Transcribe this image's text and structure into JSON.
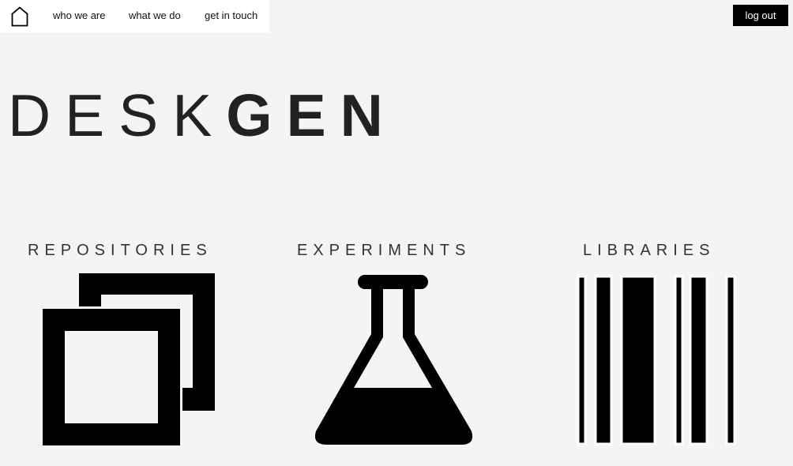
{
  "nav": {
    "home_icon": "home-icon",
    "links": [
      "who we are",
      "what we do",
      "get in touch"
    ],
    "logout_label": "log out"
  },
  "logo": {
    "light": "DESK",
    "bold": "GEN"
  },
  "sections": [
    {
      "label": "REPOSITORIES",
      "icon": "repositories-icon"
    },
    {
      "label": "EXPERIMENTS",
      "icon": "flask-icon"
    },
    {
      "label": "LIBRARIES",
      "icon": "barcode-icon"
    }
  ],
  "colors": {
    "background": "#f4f4f4",
    "nav_background": "#ffffff",
    "button_background": "#000000",
    "icon_color": "#000000"
  }
}
